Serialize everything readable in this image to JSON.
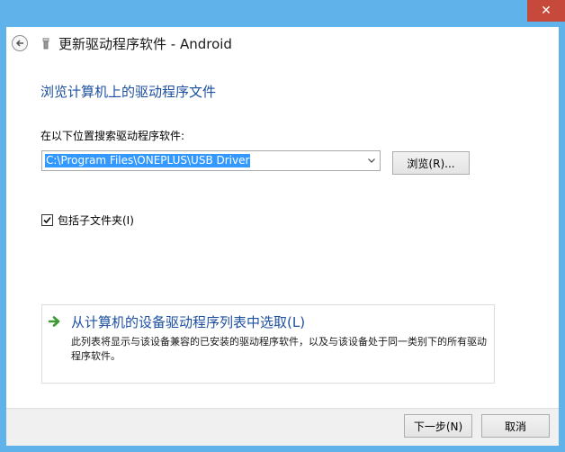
{
  "window": {
    "title": "更新驱动程序软件 - Android",
    "close_label": "✕"
  },
  "page": {
    "heading": "浏览计算机上的驱动程序文件",
    "search_label": "在以下位置搜索驱动程序软件:",
    "path_value": "C:\\Program Files\\ONEPLUS\\USB Driver",
    "browse_label": "浏览(R)...",
    "include_subfolders": {
      "label": "包括子文件夹(I)",
      "checked": true
    },
    "pick_option": {
      "title": "从计算机的设备驱动程序列表中选取(L)",
      "description": "此列表将显示与该设备兼容的已安装的驱动程序软件，以及与该设备处于同一类别下的所有驱动程序软件。"
    }
  },
  "footer": {
    "next_label": "下一步(N)",
    "cancel_label": "取消"
  },
  "colors": {
    "frame": "#5fb3ea",
    "heading_blue": "#1d4fa0",
    "selection": "#3399ff",
    "close": "#c7493b",
    "green_arrow": "#3c9b35"
  },
  "icons": [
    "back-arrow-icon",
    "usb-device-icon",
    "dropdown-arrow-icon",
    "checkmark-icon",
    "green-arrow-icon",
    "close-icon"
  ]
}
